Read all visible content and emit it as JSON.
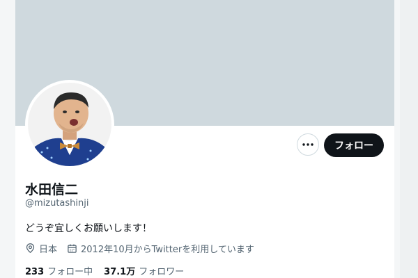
{
  "profile": {
    "display_name": "水田信二",
    "handle": "@mizutashinji",
    "bio": "どうぞ宜しくお願いします！",
    "location": "日本",
    "joined": "2012年10月からTwitterを利用しています"
  },
  "actions": {
    "more_label": "•••",
    "follow_label": "フォロー"
  },
  "stats": {
    "following_count": "233",
    "following_label": "フォロー中",
    "followers_count": "37.1万",
    "followers_label": "フォロワー"
  },
  "icons": {
    "location": "location-pin-icon",
    "calendar": "calendar-icon",
    "more": "more-horizontal-icon"
  },
  "colors": {
    "banner": "#cfd9de",
    "primary_text": "#0f1419",
    "secondary_text": "#536471",
    "follow_button": "#0f1419"
  }
}
